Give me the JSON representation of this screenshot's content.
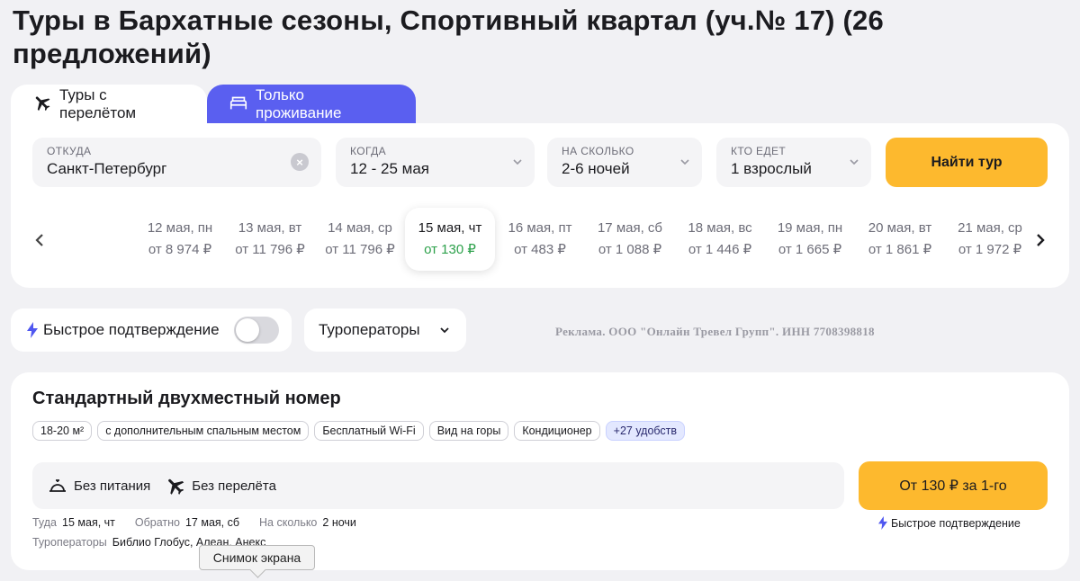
{
  "page": {
    "title": "Туры в Бархатные сезоны, Спортивный квартал (уч.№ 17) (26 предложений)"
  },
  "tabs": [
    {
      "label": "Туры с перелётом",
      "icon": "plane-icon"
    },
    {
      "label": "Только проживание",
      "icon": "bed-icon"
    }
  ],
  "search": {
    "from": {
      "label": "ОТКУДА",
      "value": "Санкт-Петербург"
    },
    "when": {
      "label": "КОГДА",
      "value": "12 - 25 мая"
    },
    "duration": {
      "label": "НА СКОЛЬКО",
      "value": "2-6 ночей"
    },
    "who": {
      "label": "КТО ЕДЕТ",
      "value": "1 взрослый"
    },
    "submit_label": "Найти тур"
  },
  "dates": [
    {
      "date": "12 мая, пн",
      "price": "от 8 974 ₽"
    },
    {
      "date": "13 мая, вт",
      "price": "от 11 796 ₽"
    },
    {
      "date": "14 мая, ср",
      "price": "от 11 796 ₽"
    },
    {
      "date": "15 мая, чт",
      "price": "от 130 ₽",
      "selected": true
    },
    {
      "date": "16 мая, пт",
      "price": "от 483 ₽"
    },
    {
      "date": "17 мая, сб",
      "price": "от 1 088 ₽"
    },
    {
      "date": "18 мая, вс",
      "price": "от 1 446 ₽"
    },
    {
      "date": "19 мая, пн",
      "price": "от 1 665 ₽"
    },
    {
      "date": "20 мая, вт",
      "price": "от 1 861 ₽"
    },
    {
      "date": "21 мая, ср",
      "price": "от 1 972 ₽"
    }
  ],
  "filters": {
    "fast_confirm_label": "Быстрое подтверждение",
    "fast_confirm_on": false,
    "operators_label": "Туроператоры",
    "ad_text": "Реклама. ООО \"Онлайн Тревел Групп\". ИНН 7708398818"
  },
  "result": {
    "room_title": "Стандартный двухместный номер",
    "amenities": [
      "18-20 м²",
      "с дополнительным спальным местом",
      "Бесплатный Wi-Fi",
      "Вид на горы",
      "Кондиционер"
    ],
    "more_amenities": "+27 удобств",
    "meal": "Без питания",
    "flight": "Без перелёта",
    "price_label": "От 130 ₽ за 1-го",
    "fast_note": "Быстрое подтверждение",
    "trip": {
      "there_label": "Туда",
      "there_value": "15 мая, чт",
      "back_label": "Обратно",
      "back_value": "17 мая, сб",
      "nights_label": "На сколько",
      "nights_value": "2 ночи"
    },
    "operators_label": "Туроператоры",
    "operators_value": "Библио Глобус, Алеан, Анекс"
  },
  "tooltip": {
    "text": "Снимок экрана"
  },
  "colors": {
    "accent": "#5a5ff0",
    "cta": "#fdb92e",
    "price_green": "#2da14b",
    "bolt": "#4f57f0"
  }
}
